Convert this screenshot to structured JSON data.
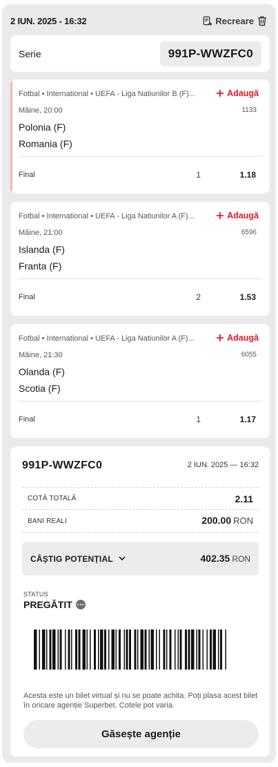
{
  "header": {
    "date": "2 IUN. 2025 - 16:32",
    "recreate_label": "Recreare"
  },
  "serie": {
    "label": "Serie",
    "value": "991P-WWZFC0"
  },
  "events": [
    {
      "league": "Fotbal • International • UEFA - Liga Natiunilor B (F)...",
      "add_label": "Adaugă",
      "time": "Mâine, 20:00",
      "code": "1133",
      "team1": "Polonia (F)",
      "team2": "Romania (F)",
      "market": "Final",
      "pick": "1",
      "odd": "1.18"
    },
    {
      "league": "Fotbal • International • UEFA - Liga Natiunilor A (F)...",
      "add_label": "Adaugă",
      "time": "Mâine, 21:00",
      "code": "6596",
      "team1": "Islanda (F)",
      "team2": "Franta (F)",
      "market": "Final",
      "pick": "2",
      "odd": "1.53"
    },
    {
      "league": "Fotbal • International • UEFA - Liga Natiunilor A (F)...",
      "add_label": "Adaugă",
      "time": "Mâine, 21:30",
      "code": "6055",
      "team1": "Olanda (F)",
      "team2": "Scotia (F)",
      "market": "Final",
      "pick": "1",
      "odd": "1.17"
    }
  ],
  "summary": {
    "code": "991P-WWZFC0",
    "date": "2 IUN. 2025 — 16:32",
    "total_odds_label": "COTĂ TOTALĂ",
    "total_odds": "2.11",
    "stake_label": "BANI REALI",
    "stake": "200.00",
    "currency": "RON",
    "potential_label": "CÂȘTIG POTENȚIAL",
    "potential": "402.35",
    "status_label": "STATUS",
    "status": "PREGĂTIT",
    "disclaimer": "Acesta este un bilet virtual și nu se poate achita. Poți plasa acest bilet în oricare agenție Superbet. Cotele pot varia.",
    "find_button": "Găsește agenție"
  },
  "colors": {
    "accent": "#e3172a",
    "background": "#e9eaec",
    "card": "#ffffff",
    "pill": "#ececee"
  },
  "icons": [
    "recreate-icon",
    "trash-icon",
    "plus-icon",
    "chevron-down-icon",
    "more-dots-icon"
  ]
}
